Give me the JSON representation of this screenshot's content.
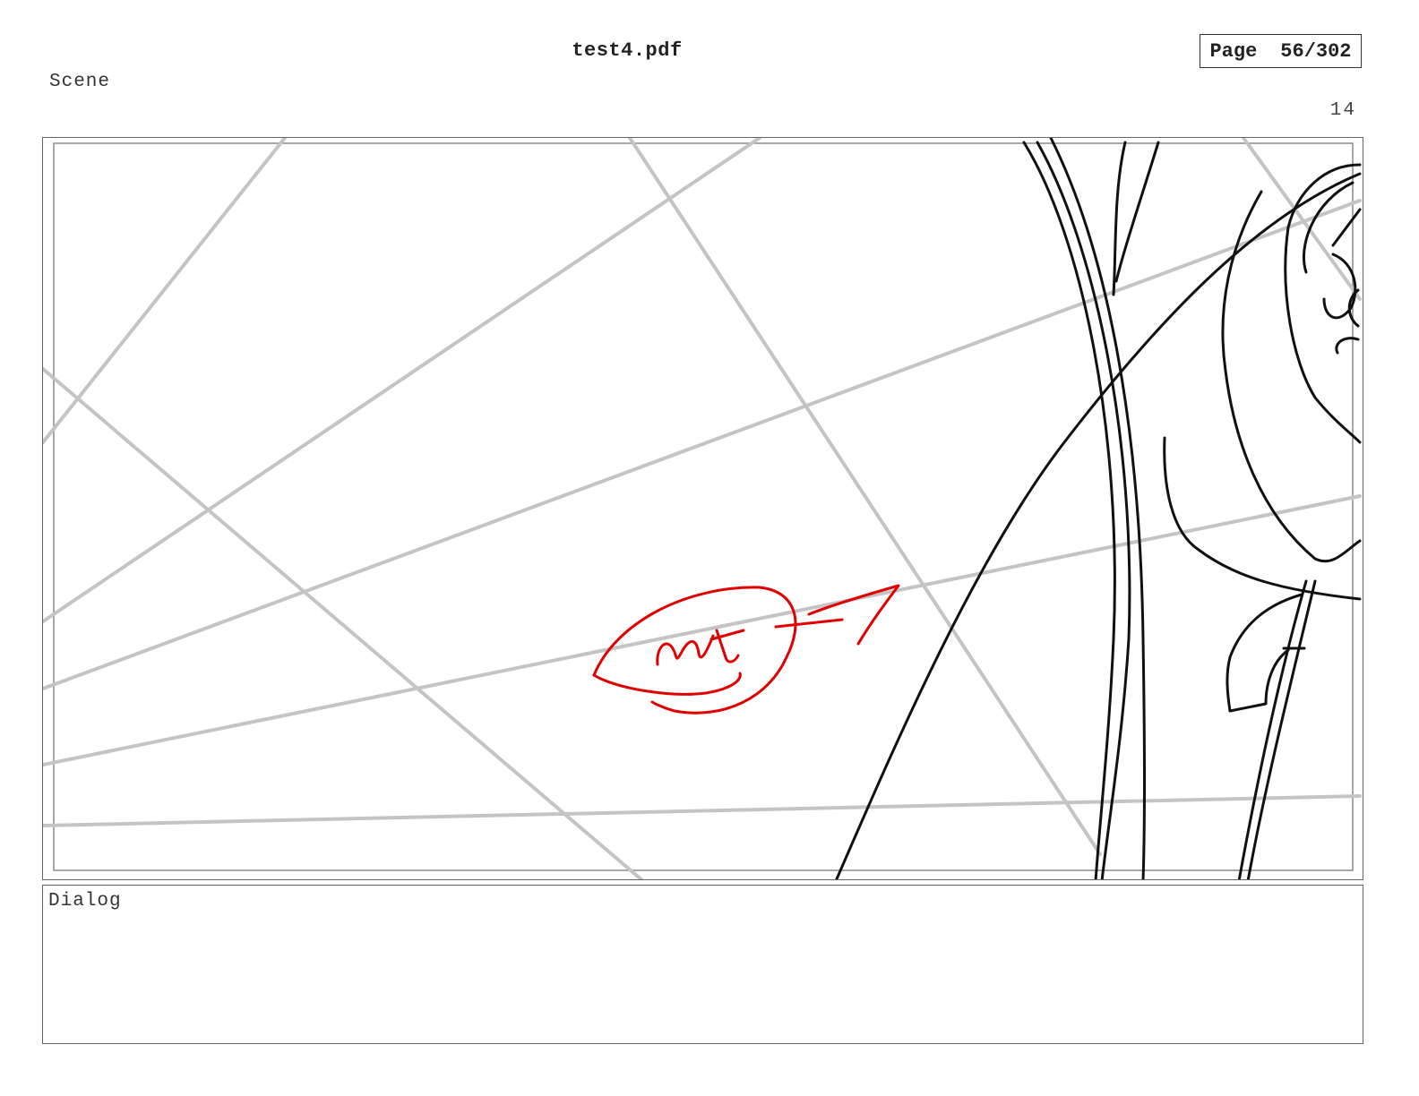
{
  "document": {
    "title": "test4.pdf",
    "page_label": "Page",
    "page_indicator": "56/302"
  },
  "scene": {
    "label": "Scene",
    "number": "14"
  },
  "panel": {
    "sketch_annotation_color": "#e00000",
    "sketch_line_color": "#111111",
    "perspective_guide_color": "#c4c4c4"
  },
  "dialog": {
    "label": "Dialog",
    "text": ""
  }
}
